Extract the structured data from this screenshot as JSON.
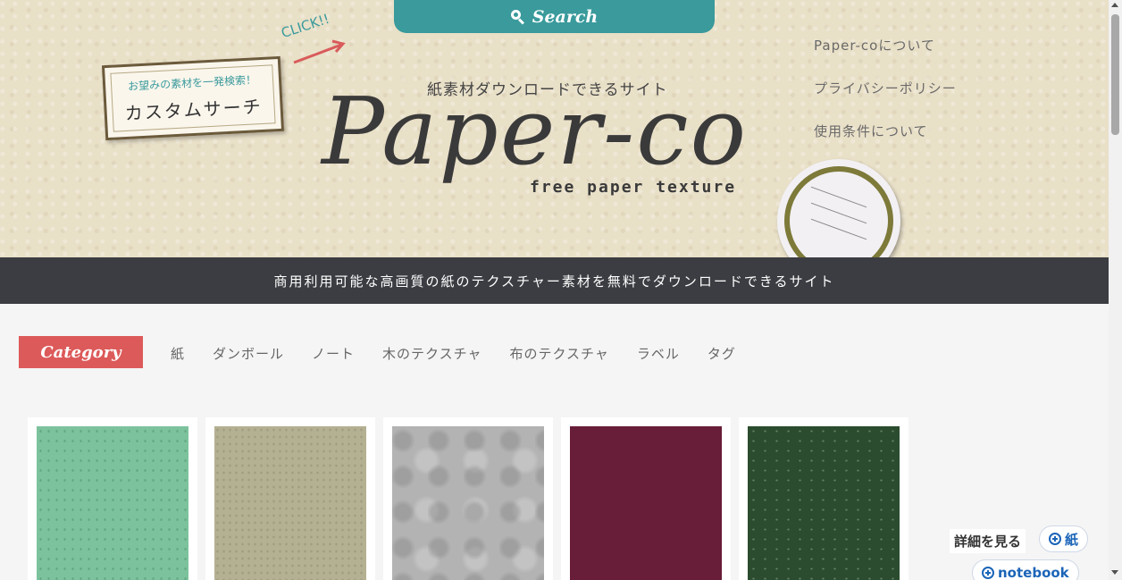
{
  "header": {
    "search_label": "Search",
    "click_label": "CLICK!!",
    "custom_search_sub": "お望みの素材を一発検索！",
    "custom_search_main": "カスタムサーチ",
    "tagline_top": "紙素材ダウンロードできるサイト",
    "logo": "Paper-co",
    "logo_sub": "free paper texture",
    "nav": [
      {
        "label": "Paper-coについて"
      },
      {
        "label": "プライバシーポリシー"
      },
      {
        "label": "使用条件について"
      }
    ]
  },
  "banner": {
    "text": "商用利用可能な高画質の紙のテクスチャー素材を無料でダウンロードできるサイト"
  },
  "category": {
    "label": "Category",
    "links": [
      {
        "label": "紙"
      },
      {
        "label": "ダンボール"
      },
      {
        "label": "ノート"
      },
      {
        "label": "木のテクスチャ"
      },
      {
        "label": "布のテクスチャ"
      },
      {
        "label": "ラベル"
      },
      {
        "label": "タグ"
      }
    ]
  },
  "cards": [
    {
      "texture": "mint-green paper",
      "color": "#7cc39d"
    },
    {
      "texture": "kraft paper",
      "color": "#b4b092"
    },
    {
      "texture": "gray marble paper",
      "color": "#b4b3b4"
    },
    {
      "texture": "wine red paper",
      "color": "#681d38"
    },
    {
      "texture": "dark green speckled paper",
      "color": "#2b4c2e"
    }
  ],
  "floating": {
    "detail": "詳細を見る",
    "tags": [
      {
        "label": "紙"
      },
      {
        "label": "notebook"
      }
    ]
  },
  "colors": {
    "teal": "#3a9a9c",
    "banner_bg": "#3c3d42",
    "category_red": "#dd5a5a",
    "tag_blue": "#1b65b8"
  }
}
